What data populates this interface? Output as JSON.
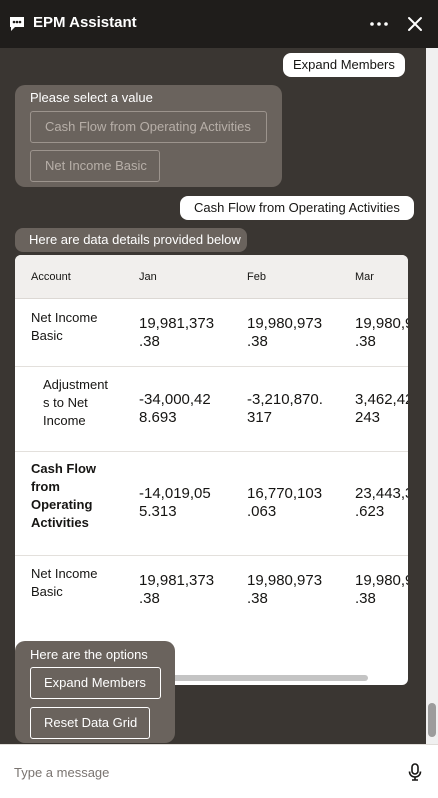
{
  "header": {
    "title": "EPM Assistant"
  },
  "messages": {
    "user1": "Expand Members",
    "select_prompt": "Please select a value",
    "select_options": [
      "Cash Flow from Operating Activities",
      "Net Income Basic"
    ],
    "user2": "Cash Flow from Operating Activities",
    "data_intro": "Here are data details provided below",
    "options_label": "Here are the options",
    "options": [
      "Expand Members",
      "Reset Data Grid"
    ]
  },
  "grid": {
    "columns": [
      "Account",
      "Jan",
      "Feb",
      "Mar"
    ],
    "rows": [
      {
        "account": "Net Income\nBasic",
        "jan": "19,981,373\n.38",
        "feb": "19,980,973\n.38",
        "mar": "19,980,9\n.38"
      },
      {
        "account": "Adjustment\ns to Net\nIncome",
        "jan": "-34,000,42\n8.693",
        "feb": "-3,210,870.\n317",
        "mar": "3,462,42\n243"
      },
      {
        "account": "Cash Flow\nfrom\nOperating\nActivities",
        "jan": "-14,019,05\n5.313",
        "feb": "16,770,103\n.063",
        "mar": "23,443,3\n.623"
      },
      {
        "account": "Net Income\nBasic",
        "jan": "19,981,373\n.38",
        "feb": "19,980,973\n.38",
        "mar": "19,980,9\n.38"
      }
    ]
  },
  "composer": {
    "placeholder": "Type a message"
  },
  "colors": {
    "header_bg": "#1f1d1b",
    "conversation_bg": "#3a3632",
    "bot_bubble": "#6a635d",
    "white": "#ffffff"
  }
}
